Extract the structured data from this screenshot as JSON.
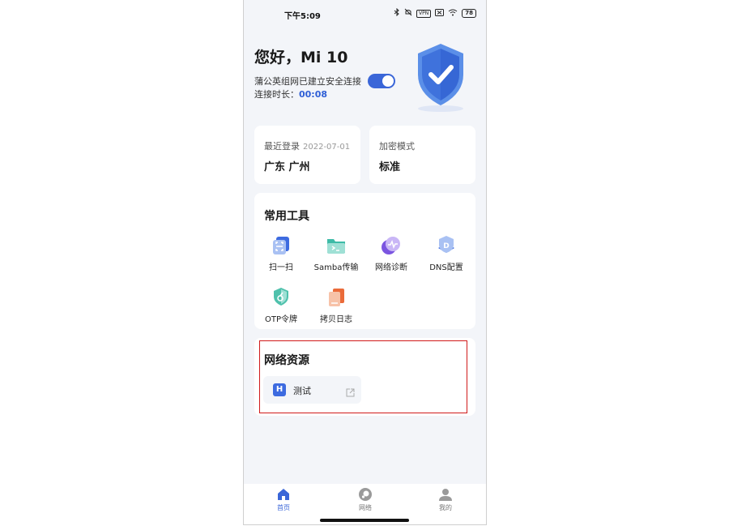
{
  "status_bar": {
    "time": "下午5:09",
    "vpn": "VPN",
    "battery": "78",
    "icons": [
      "bluetooth-icon",
      "mute-icon",
      "vpn-icon",
      "sim-off-icon",
      "wifi-icon",
      "battery-icon"
    ]
  },
  "header": {
    "greeting": "您好，Mi 10",
    "connection_text": "蒲公英组网已建立安全连接",
    "duration_label": "连接时长：",
    "duration_value": "00:08",
    "toggle_on": true,
    "shield_icon": "shield-check-icon"
  },
  "info_cards": {
    "last_login": {
      "label": "最近登录",
      "date": "2022-07-01",
      "value": "广东 广州"
    },
    "encryption": {
      "label": "加密模式",
      "value": "标准"
    }
  },
  "tools": {
    "title": "常用工具",
    "items": [
      {
        "label": "扫一扫",
        "icon": "scan-icon"
      },
      {
        "label": "Samba传输",
        "icon": "folder-terminal-icon"
      },
      {
        "label": "网络诊断",
        "icon": "network-diagnosis-icon"
      },
      {
        "label": "DNS配置",
        "icon": "dns-icon"
      },
      {
        "label": "OTP令牌",
        "icon": "otp-token-icon"
      },
      {
        "label": "拷贝日志",
        "icon": "copy-log-icon"
      }
    ]
  },
  "resources": {
    "title": "网络资源",
    "items": [
      {
        "badge": "H",
        "label": "测试",
        "icon": "external-link-icon"
      }
    ]
  },
  "tabbar": {
    "tabs": [
      {
        "label": "首页",
        "icon": "home-icon",
        "active": true
      },
      {
        "label": "网络",
        "icon": "network-icon",
        "active": false
      },
      {
        "label": "我的",
        "icon": "profile-icon",
        "active": false
      }
    ]
  },
  "colors": {
    "accent": "#3a66d8",
    "background": "#f3f5f9",
    "highlight_border": "#d11a1a"
  }
}
